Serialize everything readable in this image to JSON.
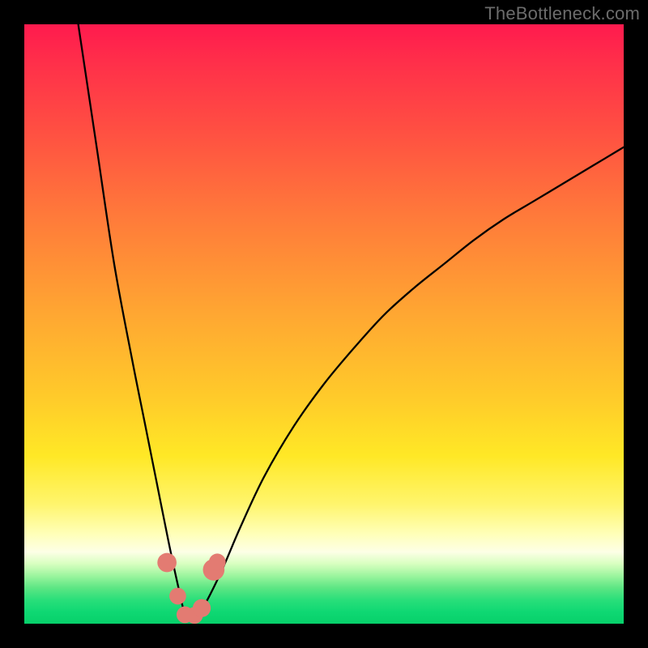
{
  "watermark": "TheBottleneck.com",
  "colors": {
    "frame": "#000000",
    "curve": "#000000",
    "beads": "#e37b72",
    "gradient_stops": [
      "#ff1a4e",
      "#ff2e4a",
      "#ff5042",
      "#ff7a3a",
      "#ffa632",
      "#ffca2a",
      "#ffe826",
      "#fff56c",
      "#ffffb8",
      "#fdffe6",
      "#d8ffc0",
      "#9cf59e",
      "#5de684",
      "#2adf7a",
      "#0fd873",
      "#07d06a"
    ]
  },
  "chart_data": {
    "type": "line",
    "title": "",
    "xlabel": "",
    "ylabel": "",
    "xlim": [
      0,
      100
    ],
    "ylim": [
      0,
      100
    ],
    "grid": false,
    "note": "Approximate V-shaped bottleneck curve; minimum near x≈27, left branch rises to ~100 at x≈9, right branch rises toward ~80 at x=100.",
    "series": [
      {
        "name": "bottleneck-curve",
        "x": [
          9,
          12,
          15,
          18,
          20,
          22,
          24,
          25.5,
          27,
          28.5,
          30,
          33,
          36,
          40,
          45,
          50,
          55,
          60,
          65,
          70,
          75,
          80,
          85,
          90,
          95,
          100
        ],
        "y": [
          100,
          80,
          60,
          44,
          34,
          24,
          14,
          7,
          1,
          1.2,
          3,
          9,
          16,
          24.5,
          33,
          40,
          46,
          51.5,
          56,
          60,
          64,
          67.5,
          70.5,
          73.5,
          76.5,
          79.5
        ]
      }
    ],
    "beads": {
      "name": "valley-markers",
      "points": [
        {
          "x": 23.8,
          "y": 10.2,
          "r": 1.6
        },
        {
          "x": 25.6,
          "y": 4.6,
          "r": 1.4
        },
        {
          "x": 26.8,
          "y": 1.5,
          "r": 1.4
        },
        {
          "x": 28.4,
          "y": 1.4,
          "r": 1.4
        },
        {
          "x": 29.6,
          "y": 2.6,
          "r": 1.5
        },
        {
          "x": 31.6,
          "y": 9.0,
          "r": 1.8
        },
        {
          "x": 32.2,
          "y": 10.3,
          "r": 1.4
        }
      ]
    }
  }
}
